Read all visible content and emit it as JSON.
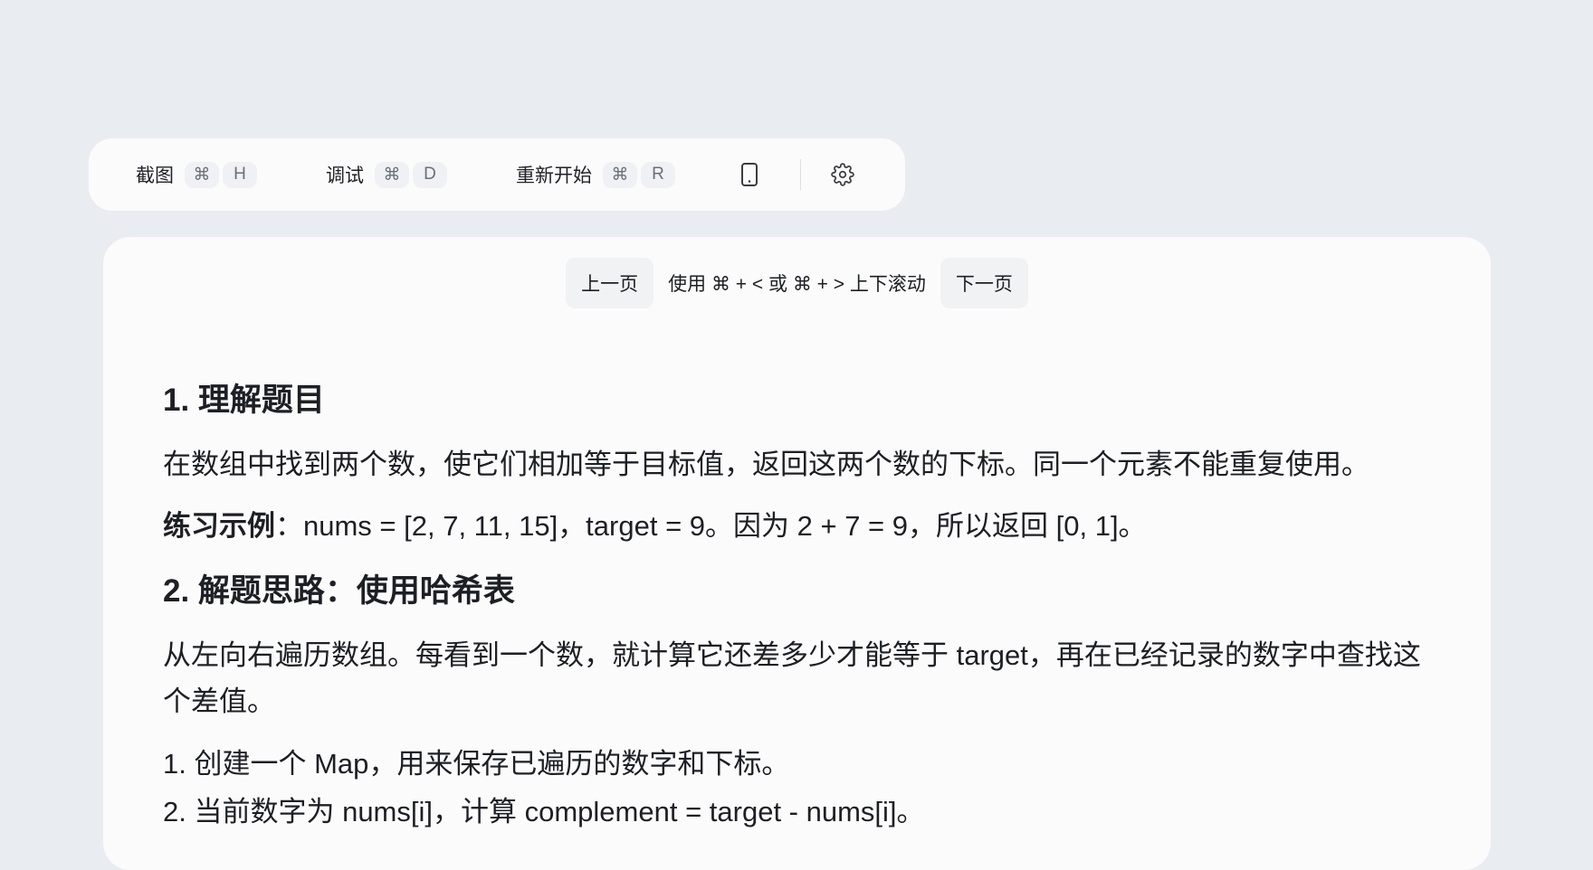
{
  "toolbar": {
    "actions": [
      {
        "label": "截图",
        "mod": "⌘",
        "key": "H"
      },
      {
        "label": "调试",
        "mod": "⌘",
        "key": "D"
      },
      {
        "label": "重新开始",
        "mod": "⌘",
        "key": "R"
      }
    ],
    "icons": [
      "phone-icon",
      "gear-icon"
    ]
  },
  "pager": {
    "prev": "上一页",
    "hint": "使用 ⌘ + < 或 ⌘ + > 上下滚动",
    "next": "下一页"
  },
  "content": {
    "section1_title": "1. 理解题目",
    "section1_desc": "在数组中找到两个数，使它们相加等于目标值，返回这两个数的下标。同一个元素不能重复使用。",
    "example_label": "练习示例",
    "example_text": "：nums = [2, 7, 11, 15]，target = 9。因为 2 + 7 = 9，所以返回 [0, 1]。",
    "section2_title": "2. 解题思路：使用哈希表",
    "section2_desc": "从左向右遍历数组。每看到一个数，就计算它还差多少才能等于 target，再在已经记录的数字中查找这个差值。",
    "steps": [
      "1. 创建一个 Map，用来保存已遍历的数字和下标。",
      "2. 当前数字为 nums[i]，计算 complement = target - nums[i]。"
    ]
  }
}
